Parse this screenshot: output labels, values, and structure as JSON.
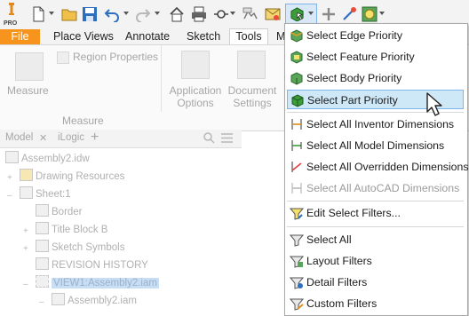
{
  "colors": {
    "file_tab": "#f7941d",
    "highlight": "#cfe8f8",
    "highlight_border": "#7eb4ea"
  },
  "toolbar": {
    "pro_badge": "PRO",
    "icons": [
      "inventor-logo-icon",
      "new-file-icon",
      "open-folder-icon",
      "save-icon",
      "undo-icon",
      "redo-icon",
      "home-icon",
      "print-icon",
      "measure-icon",
      "update-icon",
      "document-settings-icon",
      "select-priority-icon",
      "add-icon",
      "pan-icon",
      "appearance-icon"
    ]
  },
  "tabs": [
    "File",
    "Place Views",
    "Annotate",
    "Sketch",
    "Tools",
    "M"
  ],
  "ribbon": {
    "measure": "Measure",
    "region_properties": "Region Properties",
    "application_options": [
      "Application",
      "Options"
    ],
    "document_settings": [
      "Document",
      "Settings"
    ],
    "panel_label": "Measure"
  },
  "browser": {
    "tab_model": "Model",
    "tab_ilogic": "iLogic",
    "close": "✕",
    "add": "+",
    "nodes": [
      "Assembly2.idw",
      "Drawing Resources",
      "Sheet:1",
      "Border",
      "Title Block B",
      "Sketch Symbols",
      "REVISION HISTORY",
      "VIEW1:Assembly2.iam",
      "Assembly2.iam"
    ]
  },
  "menu": {
    "items": [
      {
        "label": "Select Edge Priority",
        "icon": "edge-priority-icon",
        "state": "normal"
      },
      {
        "label": "Select Feature Priority",
        "icon": "feature-priority-icon",
        "state": "normal"
      },
      {
        "label": "Select Body Priority",
        "icon": "body-priority-icon",
        "state": "normal"
      },
      {
        "label": "Select Part Priority",
        "icon": "part-priority-icon",
        "state": "highlighted"
      },
      {
        "label": "Select All Inventor Dimensions",
        "icon": "inventor-dimensions-icon",
        "state": "normal"
      },
      {
        "label": "Select All Model Dimensions",
        "icon": "model-dimensions-icon",
        "state": "normal"
      },
      {
        "label": "Select All Overridden Dimensions",
        "icon": "overridden-dimensions-icon",
        "state": "normal"
      },
      {
        "label": "Select All AutoCAD Dimensions",
        "icon": "autocad-dimensions-icon",
        "state": "disabled"
      },
      {
        "label": "Edit Select Filters...",
        "icon": "edit-filters-icon",
        "state": "normal"
      },
      {
        "label": "Select All",
        "icon": "select-all-icon",
        "state": "normal"
      },
      {
        "label": "Layout Filters",
        "icon": "layout-filters-icon",
        "state": "normal"
      },
      {
        "label": "Detail Filters",
        "icon": "detail-filters-icon",
        "state": "normal"
      },
      {
        "label": "Custom Filters",
        "icon": "custom-filters-icon",
        "state": "normal"
      }
    ]
  }
}
